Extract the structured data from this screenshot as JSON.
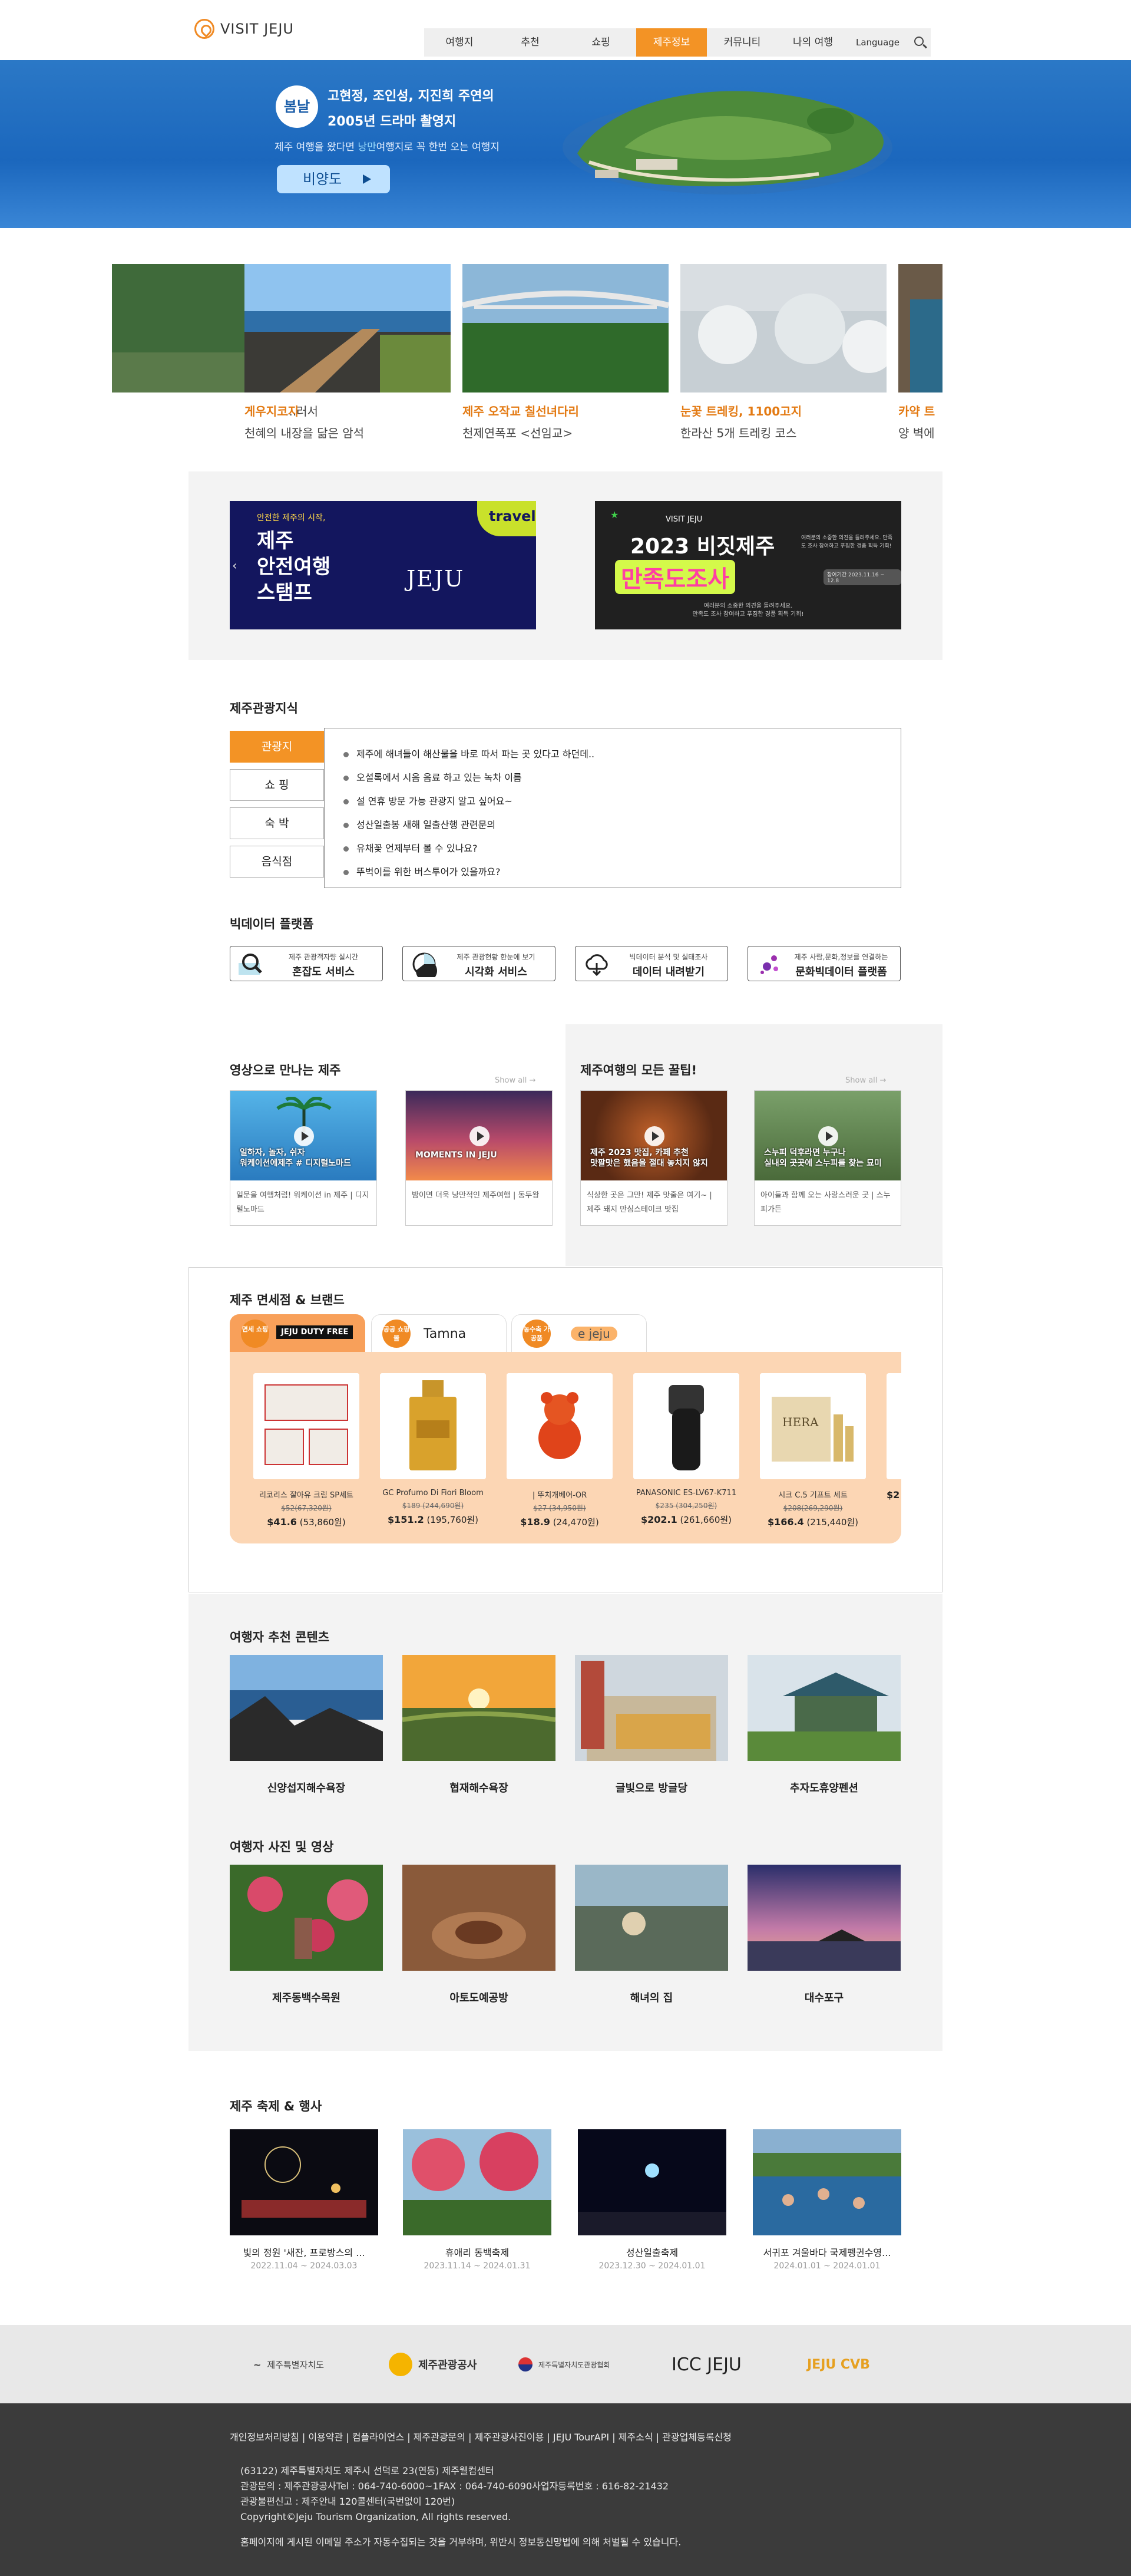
{
  "header": {
    "logo_text": "VISIT JEJU",
    "nav": [
      "여행지",
      "추천",
      "쇼핑",
      "제주정보",
      "커뮤니티",
      "나의 여행"
    ],
    "nav_active": "제주정보",
    "language": "Language"
  },
  "hero": {
    "season_badge": "봄날",
    "line1": "고현정, 조인성, 지진희 주연의",
    "line2": "2005년 드라마 촬영지",
    "desc_pre": "제주 여행을 왔다면 ",
    "desc_em": "낭만",
    "desc_post": "여행지로 꼭 한번 오는 여행지",
    "button": "비양도"
  },
  "carousel": [
    {
      "title": "",
      "desc": "...러서"
    },
    {
      "title": "게우지코지",
      "desc": "천혜의 내장을 닮은 암석"
    },
    {
      "title": "제주 오작교 칠선녀다리",
      "desc": "천제연폭포 <선임교>"
    },
    {
      "title": "눈꽃 트레킹, 1100고지",
      "desc": "한라산 5개 트레킹 코스"
    },
    {
      "title": "카약 트",
      "desc": "양 벽에"
    }
  ],
  "banners": {
    "left": {
      "small": "안전한 제주의 시작,",
      "big1": "제주",
      "big2": "안전여행",
      "big3": "스탬프",
      "brand": "JEJU",
      "tag": "travel"
    },
    "right": {
      "brand": "VISIT JEJU",
      "title1": "2023 비짓제주",
      "title2": "만족도조사",
      "side": "여러분의 소중한 의견을 들려주세요. 만족도 조사 참여하고 푸짐한 경품 획득 기회!",
      "period": "참여기간 2023.11.16 ~ 12.8",
      "foot1": "여러분의 소중한 의견을 들려주세요.",
      "foot2": "만족도 조사 참여하고 푸짐한 경품 획득 기회!"
    }
  },
  "knowledge": {
    "title": "제주관광지식",
    "tabs": [
      "관광지",
      "쇼 핑",
      "숙 박",
      "음식점"
    ],
    "active_tab": "관광지",
    "items": [
      "제주에 해녀들이 해산물을 바로 따서 파는 곳 있다고 하던데..",
      "오설록에서 시음 음료 하고 있는 녹차 이름",
      "설 연휴 방문 가능 관광지 알고 싶어요~",
      "성산일출봉 새해 일출산행 관련문의",
      "유채꽃 언제부터 볼 수 있나요?",
      "뚜벅이를 위한 버스투어가 있을까요?"
    ]
  },
  "bigdata": {
    "title": "빅데이터 플랫폼",
    "items": [
      {
        "small": "제주 관광객자량 실시간",
        "main": "혼잡도 서비스",
        "icon": "magnifier-icon"
      },
      {
        "small": "제주 관광현황 한눈에 보기",
        "main": "시각화 서비스",
        "icon": "pie-chart-icon"
      },
      {
        "small": "빅데이터 분석 및 실태조사",
        "main": "데이터 내려받기",
        "icon": "cloud-download-icon"
      },
      {
        "small": "제주 사람,문화,정보를 연결하는",
        "main": "문화빅데이터 플랫폼",
        "icon": "dots-icon"
      }
    ]
  },
  "video": {
    "title": "영상으로 만나는 제주",
    "show_all": "Show all →",
    "items": [
      {
        "cap1": "일하자, 놀자, 쉬자",
        "cap2": "워케이션에제주 # 디지털노마드",
        "desc": "일문을 여행처럼! 워케이션 in 제주 | 디지털노마드"
      },
      {
        "cap1": "MOMENTS IN JEJU",
        "cap2": "",
        "desc": "밤이면 더욱 낭만적인 제주여행 | 동두왕"
      }
    ]
  },
  "tips": {
    "title": "제주여행의 모든 꿀팁!",
    "show_all": "Show all →",
    "items": [
      {
        "cap1": "제주 2023 맛집, 카페 추천",
        "cap2": "맛팔맛은 했음을 절대 놓치지 않지",
        "desc": "식상한 곳은 그만! 제주 맛줄은 여기~ | 제주 돼지 만심스테이크 맛집"
      },
      {
        "cap1": "스누피 덕후라면 누구나",
        "cap2": "실내외 곳곳에 스누피를 찾는 묘미",
        "desc": "아이들과 함께 오는 사랑스러운 곳 | 스누피가든"
      }
    ]
  },
  "dutyfree": {
    "title": "제주 면세점 & 브랜드",
    "tabs": [
      {
        "badge": "면세 쇼핑",
        "brand": "JEJU DUTY FREE"
      },
      {
        "badge": "공공 쇼핑몰",
        "brand": "Tamna"
      },
      {
        "badge": "농수축 가공품",
        "brand": "e jeju"
      }
    ],
    "products": [
      {
        "name": "리코리스 잘아유 크림 SP세트",
        "orig": "$52(67,320원)",
        "price": "$41.6",
        "krw": "(53,860원)"
      },
      {
        "name": "GC Profumo Di Fiori Bloom",
        "orig": "$189 (244,690원)",
        "price": "$151.2",
        "krw": "(195,760원)"
      },
      {
        "name": "| 뚜치개베어-OR",
        "orig": "$27 (34,950원)",
        "price": "$18.9",
        "krw": "(24,470원)"
      },
      {
        "name": "PANASONIC ES-LV67-K711",
        "orig": "$235 (304,250원)",
        "price": "$202.1",
        "krw": "(261,660원)"
      },
      {
        "name": "시크 C.5 기프트 세트",
        "orig": "$208(269,290원)",
        "price": "$166.4",
        "krw": "(215,440원)"
      },
      {
        "name": "",
        "orig": "",
        "price": "$2",
        "krw": ""
      }
    ]
  },
  "recommend": {
    "title": "여행자 추천 콘텐츠",
    "items": [
      "신양섭지해수욕장",
      "협재해수욕장",
      "글빛으로 방글당",
      "추자도휴양펜션"
    ]
  },
  "photos": {
    "title": "여행자 사진 및 영상",
    "items": [
      "제주동백수목원",
      "아토도예공방",
      "해녀의 집",
      "대수포구"
    ]
  },
  "festival": {
    "title": "제주 축제 & 행사",
    "items": [
      {
        "name": "빛의 정원 '새잔, 프로방스의 ...",
        "date": "2022.11.04 ~ 2024.03.03"
      },
      {
        "name": "휴애리 동백축제",
        "date": "2023.11.14 ~ 2024.01.31"
      },
      {
        "name": "성산일출축제",
        "date": "2023.12.30 ~ 2024.01.01"
      },
      {
        "name": "서귀포 겨울바다 국제펭귄수영...",
        "date": "2024.01.01 ~ 2024.01.01"
      }
    ]
  },
  "partners": [
    "제주특별자치도",
    "제주관광공사",
    "제주특별자치도관광협회",
    "ICC JEJU",
    "JEJU CVB"
  ],
  "footer": {
    "links": [
      "개인정보처리방침",
      "이용약관",
      "컴플라이언스",
      "제주관광문의",
      "제주관광사진이용",
      "JEJU TourAPI",
      "제주소식",
      "관광업체등록신청"
    ],
    "address": "(63122) 제주특별자치도 제주시 선덕로 23(연동) 제주웰컴센터",
    "contact": "관광문의 : 제주관광공사Tel : 064-740-6000~1FAX : 064-740-6090사업자등록번호 : 616-82-21432",
    "call": "관광불편신고 : 제주안내 120콜센터(국번없이 120번)",
    "copyright": "Copyright©Jeju Tourism Organization, All rights reserved.",
    "notice": "홈페이지에 게시된 이메일 주소가 자동수집되는 것을 거부하며, 위반시 정보통신망법에 의해 처벌될 수 있습니다."
  }
}
